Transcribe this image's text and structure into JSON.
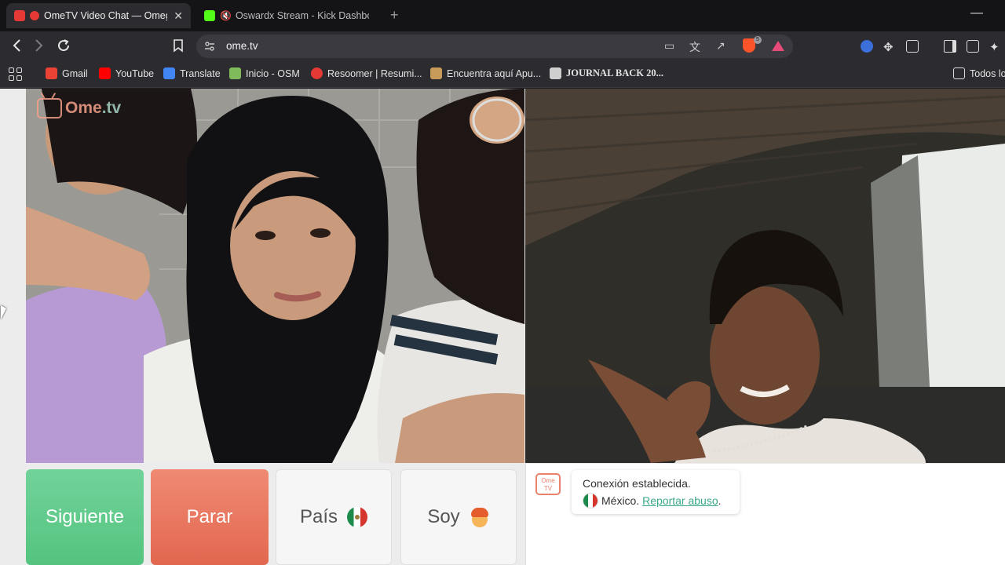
{
  "tabs": [
    {
      "title": "OmeTV Video Chat — Omeg",
      "active": true,
      "color": "#e53935"
    },
    {
      "title": "Oswardx Stream - Kick Dashboard",
      "active": false,
      "color": "#53fc18"
    }
  ],
  "address": {
    "url": "ome.tv"
  },
  "bookmarks": [
    {
      "label": "Gmail",
      "icon": "gmail-icon",
      "color": "#ea4335"
    },
    {
      "label": "YouTube",
      "icon": "youtube-icon",
      "color": "#ff0000"
    },
    {
      "label": "Translate",
      "icon": "translate-icon",
      "color": "#4285f4"
    },
    {
      "label": "Inicio - OSM",
      "icon": "osm-icon",
      "color": "#7fba5b"
    },
    {
      "label": "Resoomer | Resumi...",
      "icon": "resoomer-icon",
      "color": "#e53935"
    },
    {
      "label": "Encuentra aquí Apu...",
      "icon": "apuntes-icon",
      "color": "#c89b5b"
    },
    {
      "label": "JOURNAL BACK 20...",
      "icon": "journal-icon",
      "color": "#cfcfcf"
    }
  ],
  "bookmarks_all": "Todos lo",
  "logo": {
    "part1": "Ome",
    "part2": ".tv"
  },
  "controls": {
    "next": "Siguiente",
    "stop": "Parar",
    "country": "País",
    "gender": "Soy"
  },
  "chat": {
    "icon_text": "Ome TV",
    "status": "Conexión establecida.",
    "country": "México.",
    "report": "Reportar abuso",
    "report_suffix": "."
  }
}
